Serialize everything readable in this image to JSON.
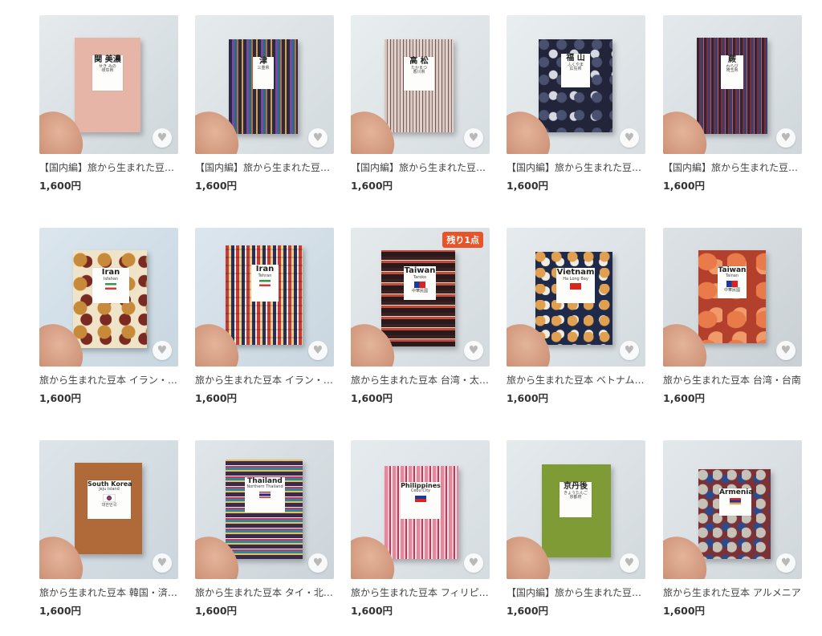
{
  "products": [
    {
      "title": "【国内編】旅から生まれた豆本 岐阜・関美濃",
      "price": "1,600円",
      "label_title": "関 美濃",
      "label_sub": "せき みの",
      "label_place": "岐阜県",
      "badge": "",
      "heart_icon": "heart-icon",
      "colors": {
        "bg": "#d9dfe2",
        "book": "#e7b7aa"
      }
    },
    {
      "title": "【国内編】旅から生まれた豆本 三重・津",
      "price": "1,600円",
      "label_title": "津",
      "label_sub": "",
      "label_place": "三重県",
      "badge": "",
      "heart_icon": "heart-icon",
      "colors": {
        "bg": "#dfe4e6",
        "book": "#3f3b5a"
      }
    },
    {
      "title": "【国内編】旅から生まれた豆本 香川・高松",
      "price": "1,600円",
      "label_title": "高 松",
      "label_sub": "たかまつ",
      "label_place": "香川県",
      "badge": "",
      "heart_icon": "heart-icon",
      "colors": {
        "bg": "#dfe6e8",
        "book": "#cbb8b2"
      }
    },
    {
      "title": "【国内編】旅から生まれた豆本 広島・福山",
      "price": "1,600円",
      "label_title": "福 山",
      "label_sub": "ふくやま",
      "label_place": "広島県",
      "badge": "",
      "heart_icon": "heart-icon",
      "colors": {
        "bg": "#e2e6e8",
        "book": "#2c2f45"
      }
    },
    {
      "title": "【国内編】旅から生まれた豆本 岐阜・蕨",
      "price": "1,600円",
      "label_title": "蕨",
      "label_sub": "わらび",
      "label_place": "埼玉県",
      "badge": "",
      "heart_icon": "heart-icon",
      "colors": {
        "bg": "#dce3e6",
        "book": "#3a2e3e"
      }
    },
    {
      "title": "旅から生まれた豆本 イラン・イスファハン",
      "price": "1,600円",
      "label_title": "Iran",
      "label_sub": "Isfahan",
      "label_place": "",
      "badge": "",
      "heart_icon": "heart-icon",
      "colors": {
        "bg": "#d6e2ea",
        "book": "#6a4a2e"
      }
    },
    {
      "title": "旅から生まれた豆本 イラン・テヘラン",
      "price": "1,600円",
      "label_title": "Iran",
      "label_sub": "Tehran",
      "label_place": "",
      "badge": "",
      "heart_icon": "heart-icon",
      "colors": {
        "bg": "#d7e2ea",
        "book": "#6e3b36"
      }
    },
    {
      "title": "旅から生まれた豆本 台湾・太魯閣",
      "price": "1,600円",
      "label_title": "Taiwan",
      "label_sub": "Taroko",
      "label_place": "中華民國",
      "badge": "残り1点",
      "heart_icon": "heart-icon",
      "colors": {
        "bg": "#dde3e6",
        "book": "#3a2224"
      }
    },
    {
      "title": "旅から生まれた豆本 ベトナム・ハロン湾",
      "price": "1,600円",
      "label_title": "Vietnam",
      "label_sub": "Ha Long Bay",
      "label_place": "",
      "badge": "",
      "heart_icon": "heart-icon",
      "colors": {
        "bg": "#dde4e8",
        "book": "#2b3554"
      }
    },
    {
      "title": "旅から生まれた豆本 台湾・台南",
      "price": "1,600円",
      "label_title": "Taiwan",
      "label_sub": "Tainan",
      "label_place": "中華民國",
      "badge": "",
      "heart_icon": "heart-icon",
      "colors": {
        "bg": "#d7dde0",
        "book": "#b5452c"
      }
    },
    {
      "title": "旅から生まれた豆本 韓国・済州島",
      "price": "1,600円",
      "label_title": "South Korea",
      "label_sub": "Jeju Island",
      "label_place": "대한민국",
      "badge": "",
      "heart_icon": "heart-icon",
      "colors": {
        "bg": "#d8e0e4",
        "book": "#b06a3a"
      }
    },
    {
      "title": "旅から生まれた豆本 タイ・北タイ",
      "price": "1,600円",
      "label_title": "Thailand",
      "label_sub": "Northern Thailand",
      "label_place": "",
      "badge": "",
      "heart_icon": "heart-icon",
      "colors": {
        "bg": "#dce3e7",
        "book": "#3b2a4a"
      }
    },
    {
      "title": "旅から生まれた豆本 フィリピン・セブ",
      "price": "1,600円",
      "label_title": "Philippines",
      "label_sub": "Cebu City",
      "label_place": "",
      "badge": "",
      "heart_icon": "heart-icon",
      "colors": {
        "bg": "#dfe5e8",
        "book": "#d9869a"
      }
    },
    {
      "title": "【国内編】旅から生まれた豆本 京都・京丹後",
      "price": "1,600円",
      "label_title": "京丹後",
      "label_sub": "きょうたんご",
      "label_place": "京都府",
      "badge": "",
      "heart_icon": "heart-icon",
      "colors": {
        "bg": "#dde3e6",
        "book": "#7e9b36"
      }
    },
    {
      "title": "旅から生まれた豆本 アルメニア",
      "price": "1,600円",
      "label_title": "Armenia",
      "label_sub": "",
      "label_place": "",
      "badge": "",
      "heart_icon": "heart-icon",
      "colors": {
        "bg": "#dfe4e7",
        "book": "#7a3236"
      }
    }
  ]
}
